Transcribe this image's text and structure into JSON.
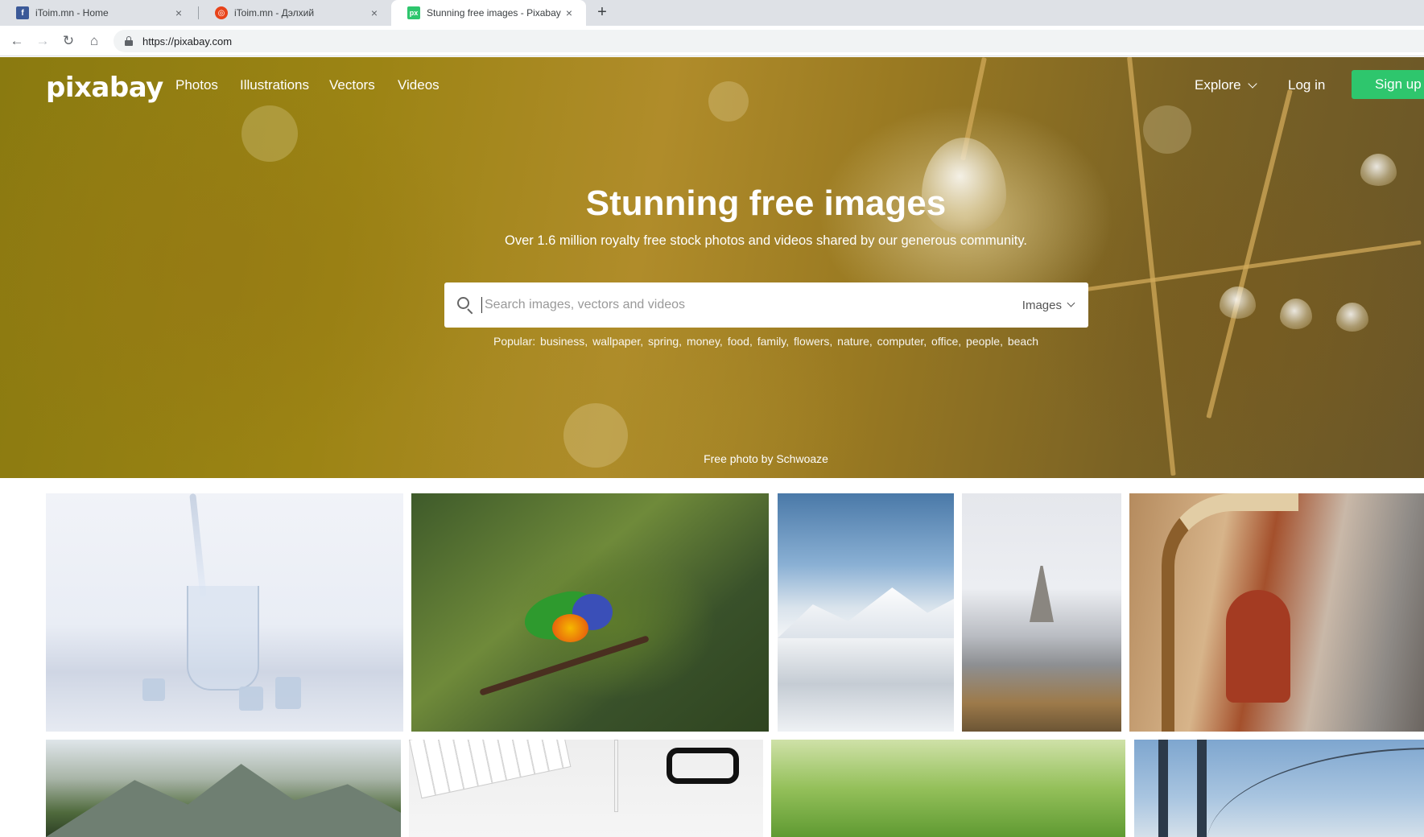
{
  "browser": {
    "tabs": [
      {
        "label": "iToim.mn - Home",
        "favicon": "facebook-icon",
        "active": false
      },
      {
        "label": "iToim.mn - Дэлхий",
        "favicon": "itoim-icon",
        "active": false
      },
      {
        "label": "Stunning free images - Pixabay",
        "favicon": "pixabay-icon",
        "active": true
      }
    ],
    "new_tab_symbol": "+",
    "close_symbol": "×",
    "url": "https://pixabay.com"
  },
  "site": {
    "logo": "pixabay",
    "nav": [
      "Photos",
      "Illustrations",
      "Vectors",
      "Videos"
    ],
    "explore_label": "Explore",
    "login_label": "Log in",
    "signup_label": "Sign up",
    "accent_color": "#2ec66d"
  },
  "hero": {
    "title": "Stunning free images",
    "subtitle": "Over 1.6 million royalty free stock photos and videos shared by our generous community.",
    "search_placeholder": "Search images, vectors and videos",
    "search_type": "Images",
    "popular_label": "Popular:",
    "popular_terms": [
      "business,",
      "wallpaper,",
      "spring,",
      "money,",
      "food,",
      "family,",
      "flowers,",
      "nature,",
      "computer,",
      "office,",
      "people,",
      "beach"
    ],
    "credit": "Free photo by Schwoaze"
  },
  "gallery": [
    {
      "subject": "water glass with ice cubes"
    },
    {
      "subject": "rainbow lorikeet parrot"
    },
    {
      "subject": "snowy mountain road"
    },
    {
      "subject": "Eiffel Tower Paris"
    },
    {
      "subject": "woman playing harp"
    },
    {
      "subject": "alpine mountain valley"
    },
    {
      "subject": "desk with keyboard, pen and glasses"
    },
    {
      "subject": "green grass"
    },
    {
      "subject": "Golden Gate Bridge"
    }
  ]
}
